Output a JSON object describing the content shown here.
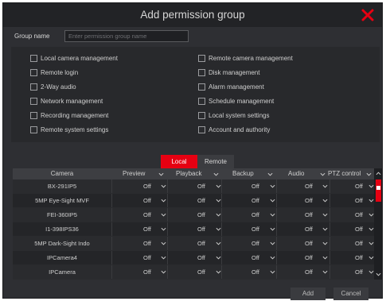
{
  "dialog": {
    "title": "Add permission group"
  },
  "group_name": {
    "label": "Group name",
    "placeholder": "Enter permission group name",
    "value": ""
  },
  "permissions_left": [
    "Local camera management",
    "Remote login",
    "2-Way audio",
    "Network management",
    "Recording management",
    "Remote system settings"
  ],
  "permissions_right": [
    "Remote camera management",
    "Disk management",
    "Alarm management",
    "Schedule management",
    "Local system settings",
    "Account and authority"
  ],
  "tabs": [
    {
      "label": "Local",
      "active": true
    },
    {
      "label": "Remote",
      "active": false
    }
  ],
  "table": {
    "columns": [
      "Camera",
      "Preview",
      "Playback",
      "Backup",
      "Audio",
      "PTZ control"
    ],
    "rows": [
      {
        "camera": "BX-291IP5",
        "values": [
          "Off",
          "Off",
          "Off",
          "Off",
          "Off"
        ]
      },
      {
        "camera": "5MP Eye-Sight MVF",
        "values": [
          "Off",
          "Off",
          "Off",
          "Off",
          "Off"
        ]
      },
      {
        "camera": "FEI-360IP5",
        "values": [
          "Off",
          "Off",
          "Off",
          "Off",
          "Off"
        ]
      },
      {
        "camera": "I1-398IPS36",
        "values": [
          "Off",
          "Off",
          "Off",
          "Off",
          "Off"
        ]
      },
      {
        "camera": "5MP Dark-Sight Indo",
        "values": [
          "Off",
          "Off",
          "Off",
          "Off",
          "Off"
        ]
      },
      {
        "camera": "IPCamera4",
        "values": [
          "Off",
          "Off",
          "Off",
          "Off",
          "Off"
        ]
      },
      {
        "camera": "IPCamera",
        "values": [
          "Off",
          "Off",
          "Off",
          "Off",
          "Off"
        ]
      }
    ]
  },
  "buttons": {
    "add": "Add",
    "cancel": "Cancel"
  },
  "colors": {
    "accent": "#e60012",
    "background": "#2e2f33"
  }
}
